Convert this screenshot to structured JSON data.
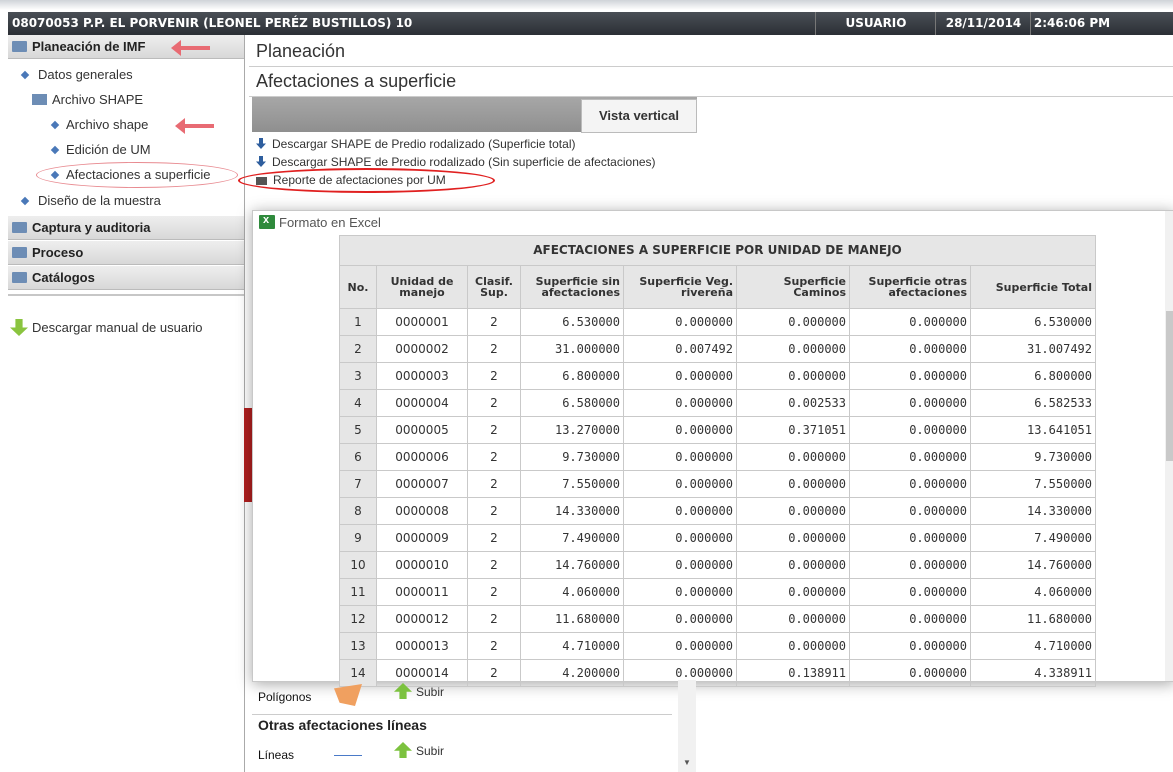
{
  "titlebar": {
    "title": "08070053 P.P. EL PORVENIR (LEONEL PERÉZ BUSTILLOS) 10",
    "user": "USUARIO",
    "date": "28/11/2014",
    "time": "2:46:06 PM"
  },
  "sidebar": {
    "planeacion": "Planeación de IMF",
    "datos_generales": "Datos generales",
    "archivo_shape_folder": "Archivo SHAPE",
    "archivo_shape": "Archivo shape",
    "edicion_um": "Edición de UM",
    "afectaciones": "Afectaciones a superficie",
    "diseno": "Diseño de la muestra",
    "captura": "Captura y auditoria",
    "proceso": "Proceso",
    "catalogos": "Catálogos",
    "manual": "Descargar manual de usuario"
  },
  "main": {
    "planeacion": "Planeación",
    "afectaciones": "Afectaciones a superficie",
    "vista_vertical": "Vista vertical",
    "link1": "Descargar SHAPE de Predio rodalizado (Superficie total)",
    "link2": "Descargar SHAPE de Predio rodalizado (Sin superficie de afectaciones)",
    "link3": "Reporte de afectaciones por UM"
  },
  "popup": {
    "excel": "Formato en Excel",
    "caption": "AFECTACIONES A SUPERFICIE POR UNIDAD DE MANEJO",
    "headers": [
      "No.",
      "Unidad de manejo",
      "Clasif. Sup.",
      "Superficie sin afectaciones",
      "Superficie Veg. rivereña",
      "Superficie Caminos",
      "Superficie otras afectaciones",
      "Superficie Total"
    ],
    "rows": [
      [
        "1",
        "0000001",
        "2",
        "6.530000",
        "0.000000",
        "0.000000",
        "0.000000",
        "6.530000"
      ],
      [
        "2",
        "0000002",
        "2",
        "31.000000",
        "0.007492",
        "0.000000",
        "0.000000",
        "31.007492"
      ],
      [
        "3",
        "0000003",
        "2",
        "6.800000",
        "0.000000",
        "0.000000",
        "0.000000",
        "6.800000"
      ],
      [
        "4",
        "0000004",
        "2",
        "6.580000",
        "0.000000",
        "0.002533",
        "0.000000",
        "6.582533"
      ],
      [
        "5",
        "0000005",
        "2",
        "13.270000",
        "0.000000",
        "0.371051",
        "0.000000",
        "13.641051"
      ],
      [
        "6",
        "0000006",
        "2",
        "9.730000",
        "0.000000",
        "0.000000",
        "0.000000",
        "9.730000"
      ],
      [
        "7",
        "0000007",
        "2",
        "7.550000",
        "0.000000",
        "0.000000",
        "0.000000",
        "7.550000"
      ],
      [
        "8",
        "0000008",
        "2",
        "14.330000",
        "0.000000",
        "0.000000",
        "0.000000",
        "14.330000"
      ],
      [
        "9",
        "0000009",
        "2",
        "7.490000",
        "0.000000",
        "0.000000",
        "0.000000",
        "7.490000"
      ],
      [
        "10",
        "0000010",
        "2",
        "14.760000",
        "0.000000",
        "0.000000",
        "0.000000",
        "14.760000"
      ],
      [
        "11",
        "0000011",
        "2",
        "4.060000",
        "0.000000",
        "0.000000",
        "0.000000",
        "4.060000"
      ],
      [
        "12",
        "0000012",
        "2",
        "11.680000",
        "0.000000",
        "0.000000",
        "0.000000",
        "11.680000"
      ],
      [
        "13",
        "0000013",
        "2",
        "4.710000",
        "0.000000",
        "0.000000",
        "0.000000",
        "4.710000"
      ],
      [
        "14",
        "0000014",
        "2",
        "4.200000",
        "0.000000",
        "0.138911",
        "0.000000",
        "4.338911"
      ]
    ]
  },
  "lower": {
    "poligonos": "Polígonos",
    "subir1": "Subir",
    "otras": "Otras afectaciones líneas",
    "lineas": "Líneas",
    "subir2": "Subir"
  }
}
